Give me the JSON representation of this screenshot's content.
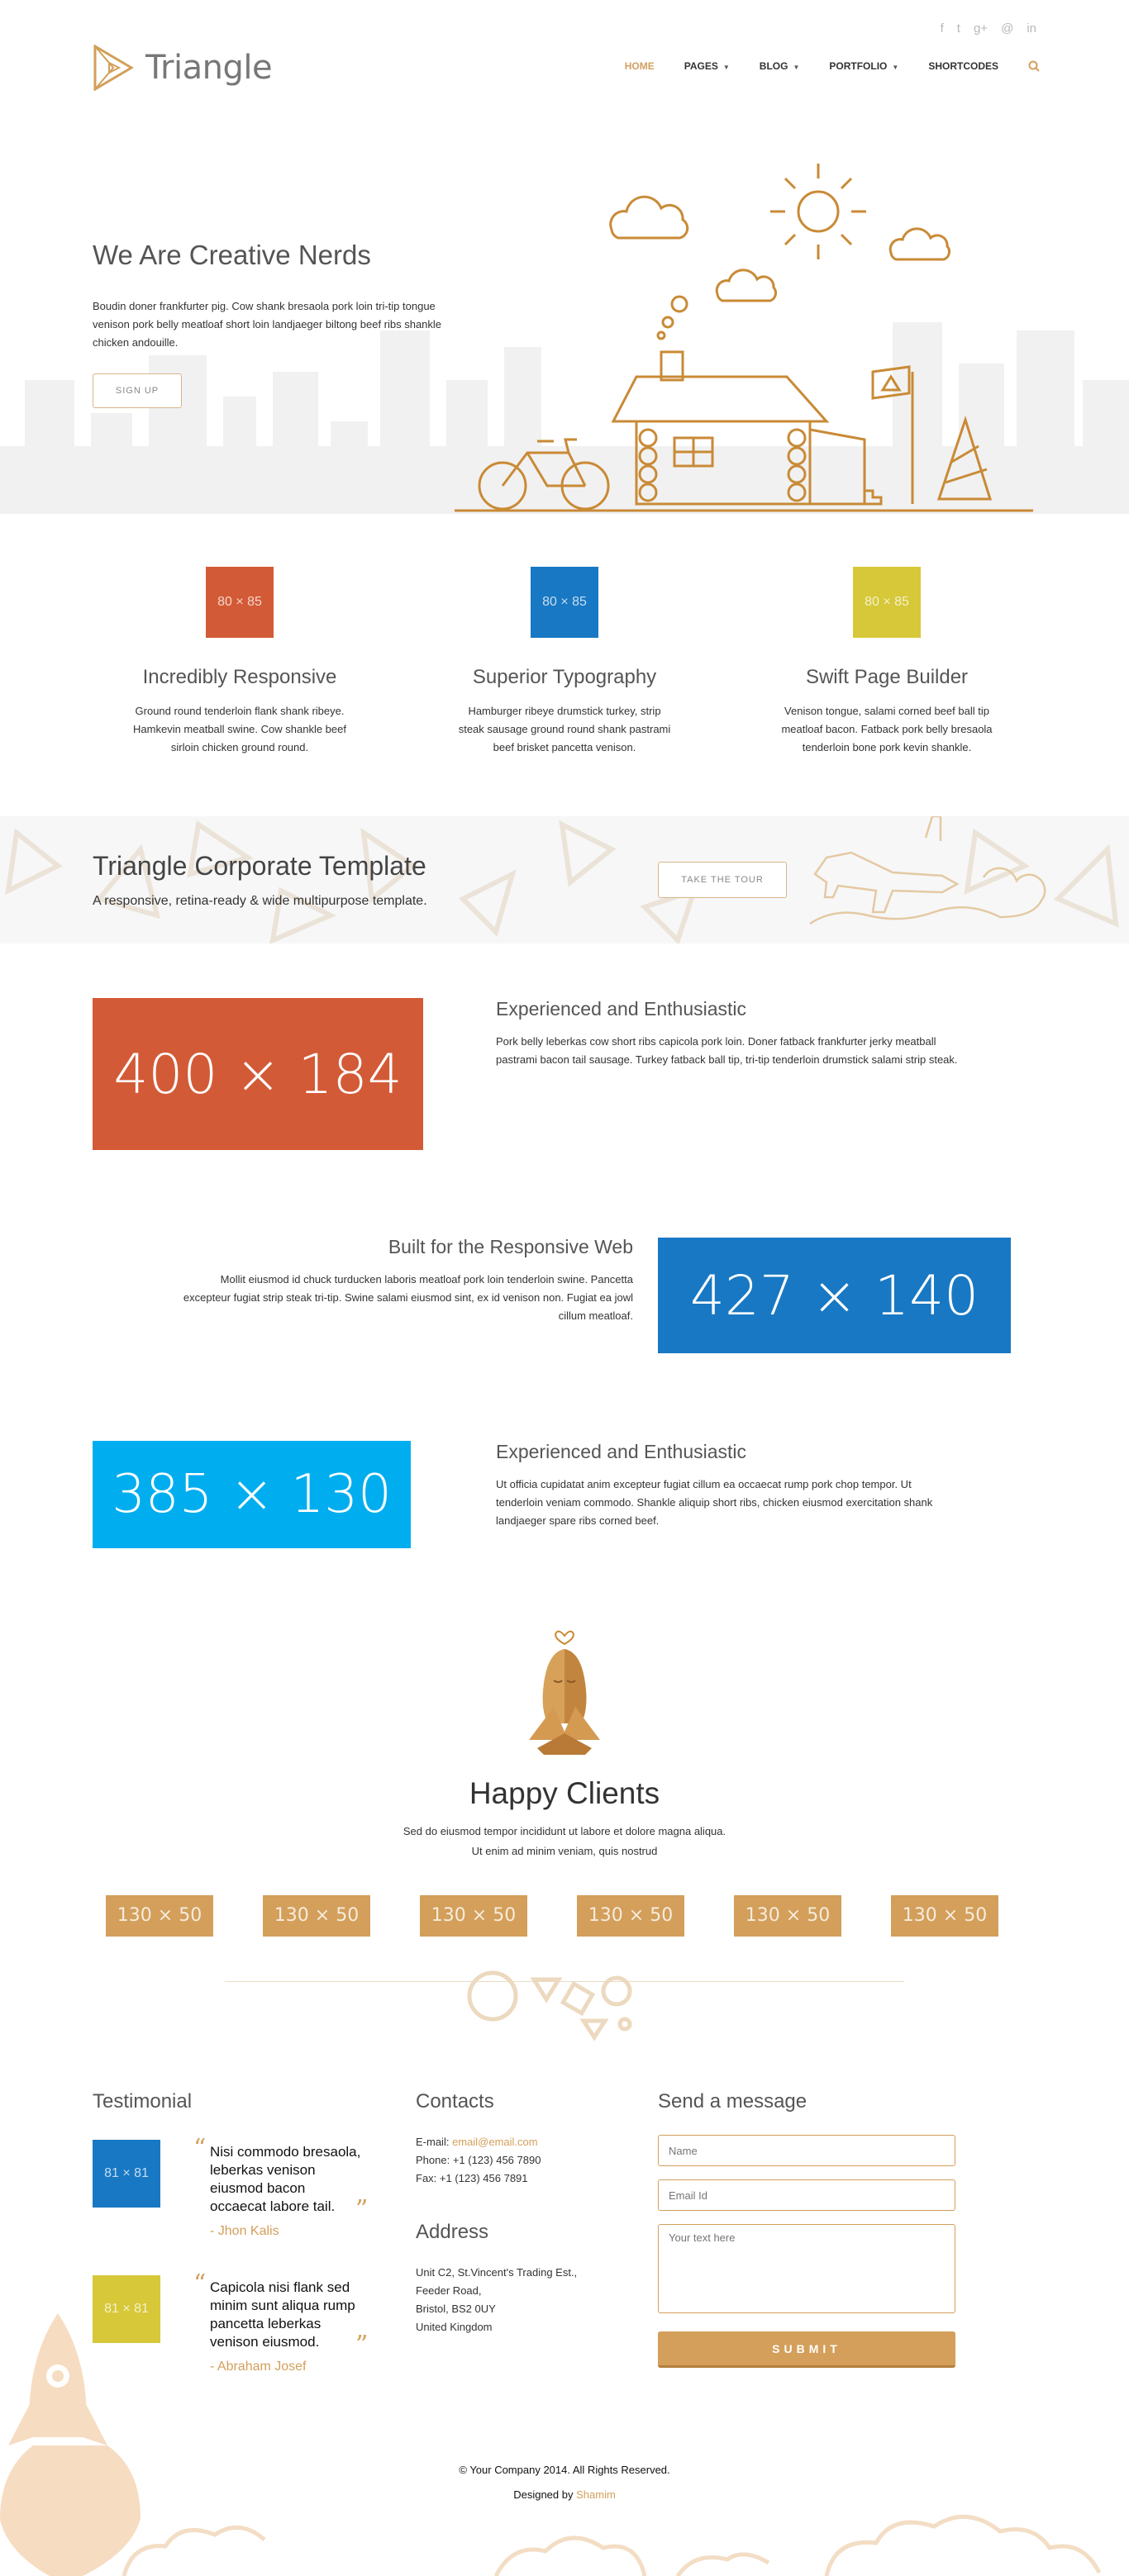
{
  "header": {
    "brand": "Triangle",
    "social": [
      {
        "icon": "facebook-icon",
        "glyph": "f"
      },
      {
        "icon": "twitter-icon",
        "glyph": "t"
      },
      {
        "icon": "google-plus-icon",
        "glyph": "g+"
      },
      {
        "icon": "dribbble-icon",
        "glyph": "@"
      },
      {
        "icon": "linkedin-icon",
        "glyph": "in"
      }
    ],
    "nav": {
      "home": "HOME",
      "pages": "PAGES",
      "blog": "BLOG",
      "portfolio": "PORTFOLIO",
      "shortcodes": "SHORTCODES"
    }
  },
  "hero": {
    "title": "We Are Creative Nerds",
    "text": "Boudin doner frankfurter pig. Cow shank bresaola pork loin tri-tip tongue venison pork belly meatloaf short loin landjaeger biltong beef ribs shankle chicken andouille.",
    "button": "SIGN UP"
  },
  "features": [
    {
      "box": "80 × 85",
      "title": "Incredibly Responsive",
      "text": "Ground round tenderloin flank shank ribeye. Hamkevin meatball swine. Cow shankle beef sirloin chicken ground round."
    },
    {
      "box": "80 × 85",
      "title": "Superior Typography",
      "text": "Hamburger ribeye drumstick turkey, strip steak sausage ground round shank pastrami beef brisket pancetta venison."
    },
    {
      "box": "80 × 85",
      "title": "Swift Page Builder",
      "text": "Venison tongue, salami corned beef ball tip meatloaf bacon. Fatback pork belly bresaola tenderloin bone pork kevin shankle."
    }
  ],
  "banner": {
    "title": "Triangle Corporate Template",
    "subtitle": "A responsive, retina-ready & wide multipurpose template.",
    "button": "TAKE THE TOUR"
  },
  "rows": [
    {
      "image": "400 × 184",
      "title": "Experienced and Enthusiastic",
      "text": "Pork belly leberkas cow short ribs capicola pork loin. Doner fatback frankfurter jerky meatball pastrami bacon tail sausage. Turkey fatback ball tip, tri-tip tenderloin drumstick salami strip steak."
    },
    {
      "image": "427 × 140",
      "title": "Built for the Responsive Web",
      "text": "Mollit eiusmod id chuck turducken laboris meatloaf pork loin tenderloin swine. Pancetta excepteur fugiat strip steak tri-tip. Swine salami eiusmod sint, ex id venison non. Fugiat ea jowl cillum meatloaf."
    },
    {
      "image": "385 × 130",
      "title": "Experienced and Enthusiastic",
      "text": "Ut officia cupidatat anim excepteur fugiat cillum ea occaecat rump pork chop tempor. Ut tenderloin veniam commodo. Shankle aliquip short ribs, chicken eiusmod exercitation shank landjaeger spare ribs corned beef."
    }
  ],
  "clients": {
    "title": "Happy Clients",
    "text_line1": "Sed do eiusmod tempor incididunt ut labore et dolore magna aliqua.",
    "text_line2": "Ut enim ad minim veniam, quis nostrud",
    "logos": [
      "130 × 50",
      "130 × 50",
      "130 × 50",
      "130 × 50",
      "130 × 50",
      "130 × 50"
    ]
  },
  "footer": {
    "testimonial_heading": "Testimonial",
    "testimonials": [
      {
        "image": "81 × 81",
        "quote": "Nisi commodo bresaola, leberkas venison eiusmod bacon occaecat labore tail.",
        "author": "- Jhon Kalis"
      },
      {
        "image": "81 × 81",
        "quote": "Capicola nisi flank sed minim sunt aliqua rump pancetta leberkas venison eiusmod.",
        "author": "- Abraham Josef"
      }
    ],
    "contacts_heading": "Contacts",
    "email_label": "E-mail:",
    "email": "email@email.com",
    "phone": "Phone: +1 (123) 456 7890",
    "fax": "Fax: +1 (123) 456 7891",
    "address_heading": "Address",
    "address": [
      "Unit C2, St.Vincent's Trading Est.,",
      "Feeder Road,",
      "Bristol, BS2 0UY",
      "United Kingdom"
    ],
    "message_heading": "Send a message",
    "name_placeholder": "Name",
    "email_placeholder": "Email Id",
    "text_placeholder": "Your text here",
    "submit": "SUBMIT",
    "copyright": "© Your Company 2014. All Rights Reserved.",
    "designed_by": "Designed by",
    "designer": "Shamim"
  },
  "colors": {
    "accent": "#d39f5a",
    "orange": "#d35a36",
    "blue": "#1878c3",
    "yellow": "#d6c838",
    "light_blue": "#00aeef"
  }
}
